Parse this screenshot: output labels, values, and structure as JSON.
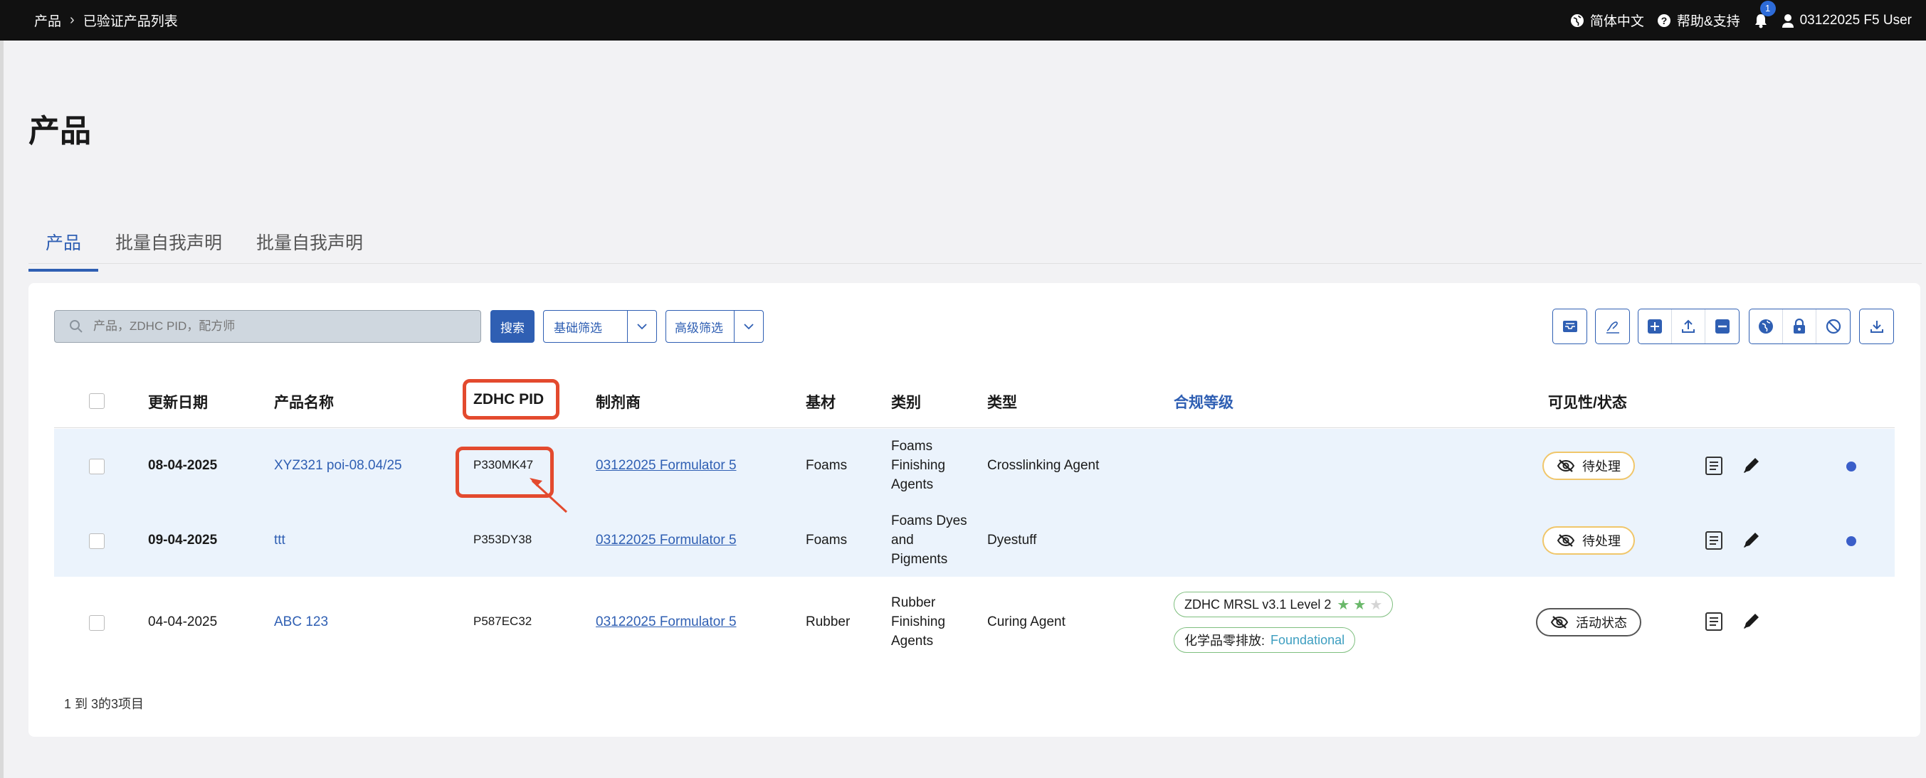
{
  "topbar": {
    "breadcrumb": [
      "产品",
      "已验证产品列表"
    ],
    "language": "简体中文",
    "help": "帮助&支持",
    "notification_count": "1",
    "user": "03122025 F5 User"
  },
  "page": {
    "title": "产品"
  },
  "tabs": [
    "产品",
    "批量自我声明",
    "批量自我声明"
  ],
  "toolbar": {
    "search_placeholder": "产品，ZDHC PID，配方师",
    "search_button": "搜索",
    "basic_filter": "基础筛选",
    "advanced_filter": "高级筛选",
    "icons": [
      "inbox-icon",
      "sign-icon",
      "add-icon",
      "upload-icon",
      "remove-icon",
      "globe-icon",
      "lock-icon",
      "block-icon",
      "download-icon"
    ]
  },
  "table": {
    "headers": {
      "date": "更新日期",
      "name": "产品名称",
      "pid": "ZDHC PID",
      "formulator": "制剂商",
      "substrate": "基材",
      "category": "类别",
      "type": "类型",
      "compliance": "合规等级",
      "visibility": "可见性/状态"
    },
    "rows": [
      {
        "date": "08-04-2025",
        "name": "XYZ321 poi-08.04/25",
        "pid": "P330MK47",
        "formulator": "03122025 Formulator 5",
        "substrate": "Foams",
        "category_lines": [
          "Foams",
          "Finishing",
          "Agents"
        ],
        "type": "Crosslinking Agent",
        "status": "待处理"
      },
      {
        "date": "09-04-2025",
        "name": "ttt",
        "pid": "P353DY38",
        "formulator": "03122025 Formulator 5",
        "substrate": "Foams",
        "category_lines": [
          "Foams Dyes",
          "and",
          "Pigments"
        ],
        "type": "Dyestuff",
        "status": "待处理"
      },
      {
        "date": "04-04-2025",
        "name": "ABC 123",
        "pid": "P587EC32",
        "formulator": "03122025 Formulator 5",
        "substrate": "Rubber",
        "category_lines": [
          "Rubber",
          "Finishing",
          "Agents"
        ],
        "type": "Curing Agent",
        "compliance": {
          "mrsl_label": "ZDHC MRSL v3.1 Level 2",
          "mrsl_stars": 2,
          "mrsl_stars_max": 3,
          "zero_label": "化学品零排放:",
          "zero_level": "Foundational"
        },
        "status": "活动状态"
      }
    ]
  },
  "footer": {
    "summary": "1 到 3的3项目"
  },
  "colors": {
    "accent": "#2f5fb3",
    "highlight": "#e34a2e",
    "pending_border": "#f0c66a",
    "row_highlight": "#ebf3fc"
  }
}
